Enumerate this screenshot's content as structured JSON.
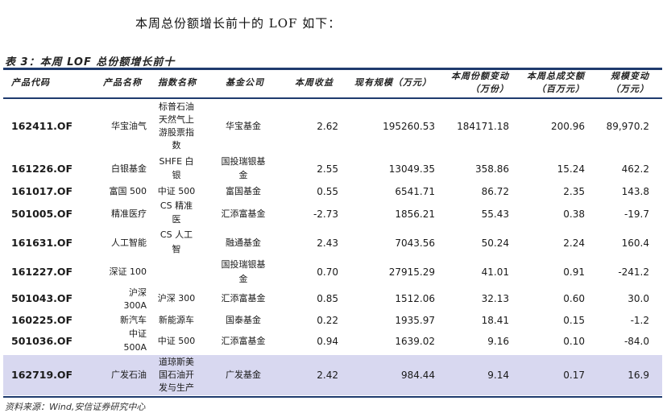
{
  "intro_text": "本周总份额增长前十的 LOF 如下：",
  "table": {
    "caption": "表 3：本周 LOF 总份额增长前十",
    "headers": {
      "code": "产品代码",
      "name": "产品名称",
      "index": "指数名称",
      "company": "基金公司",
      "weekly_return": "本周收益",
      "scale": "现有规模（万元）",
      "share_change": [
        "本周份额变动",
        "（万份）"
      ],
      "volume": [
        "本周总成交额",
        "（百万元）"
      ],
      "scale_change": [
        "规模变动",
        "（万元）"
      ]
    },
    "rows": [
      {
        "code": "162411.OF",
        "name": "华宝油气",
        "index": [
          "标普石油",
          "天然气上",
          "游股票指",
          "数"
        ],
        "company": [
          "华宝基金"
        ],
        "weekly_return": "2.62",
        "scale": "195260.53",
        "share_change": "184171.18",
        "volume": "200.96",
        "scale_change": "89,970.2"
      },
      {
        "code": "161226.OF",
        "name": "白银基金",
        "index": [
          "SHFE 白",
          "银"
        ],
        "company": [
          "国投瑞银基",
          "金"
        ],
        "weekly_return": "2.55",
        "scale": "13049.35",
        "share_change": "358.86",
        "volume": "15.24",
        "scale_change": "462.2"
      },
      {
        "code": "161017.OF",
        "name": "富国 500",
        "index": [
          "中证 500"
        ],
        "company": [
          "富国基金"
        ],
        "weekly_return": "0.55",
        "scale": "6541.71",
        "share_change": "86.72",
        "volume": "2.35",
        "scale_change": "143.8"
      },
      {
        "code": "501005.OF",
        "name": "精准医疗",
        "index": [
          "CS 精准",
          "医"
        ],
        "company": [
          "汇添富基金"
        ],
        "weekly_return": "-2.73",
        "scale": "1856.21",
        "share_change": "55.43",
        "volume": "0.38",
        "scale_change": "-19.7"
      },
      {
        "code": "161631.OF",
        "name": "人工智能",
        "index": [
          "CS 人工",
          "智"
        ],
        "company": [
          "融通基金"
        ],
        "weekly_return": "2.43",
        "scale": "7043.56",
        "share_change": "50.24",
        "volume": "2.24",
        "scale_change": "160.4"
      },
      {
        "code": "161227.OF",
        "name": "深证 100",
        "index": [],
        "company": [
          "国投瑞银基",
          "金"
        ],
        "weekly_return": "0.70",
        "scale": "27915.29",
        "share_change": "41.01",
        "volume": "0.91",
        "scale_change": "-241.2"
      },
      {
        "code": "501043.OF",
        "name": [
          "沪深",
          "300A"
        ],
        "index": [
          "沪深 300"
        ],
        "company": [
          "汇添富基金"
        ],
        "weekly_return": "0.85",
        "scale": "1512.06",
        "share_change": "32.13",
        "volume": "0.60",
        "scale_change": "30.0"
      },
      {
        "code": "160225.OF",
        "name": "新汽车",
        "index": [
          "新能源车"
        ],
        "company": [
          "国泰基金"
        ],
        "weekly_return": "0.22",
        "scale": "1935.97",
        "share_change": "18.41",
        "volume": "0.15",
        "scale_change": "-1.2"
      },
      {
        "code": "501036.OF",
        "name": [
          "中证",
          "500A"
        ],
        "index": [
          "中证 500"
        ],
        "company": [
          "汇添富基金"
        ],
        "weekly_return": "0.94",
        "scale": "1639.02",
        "share_change": "9.16",
        "volume": "0.10",
        "scale_change": "-84.0"
      },
      {
        "code": "162719.OF",
        "name": "广发石油",
        "index": [
          "道琼斯美",
          "国石油开",
          "发与生产"
        ],
        "company": [
          "广发基金"
        ],
        "weekly_return": "2.42",
        "scale": "984.44",
        "share_change": "9.14",
        "volume": "0.17",
        "scale_change": "16.9"
      }
    ],
    "source": "资料来源：Wind,安信证券研究中心"
  }
}
